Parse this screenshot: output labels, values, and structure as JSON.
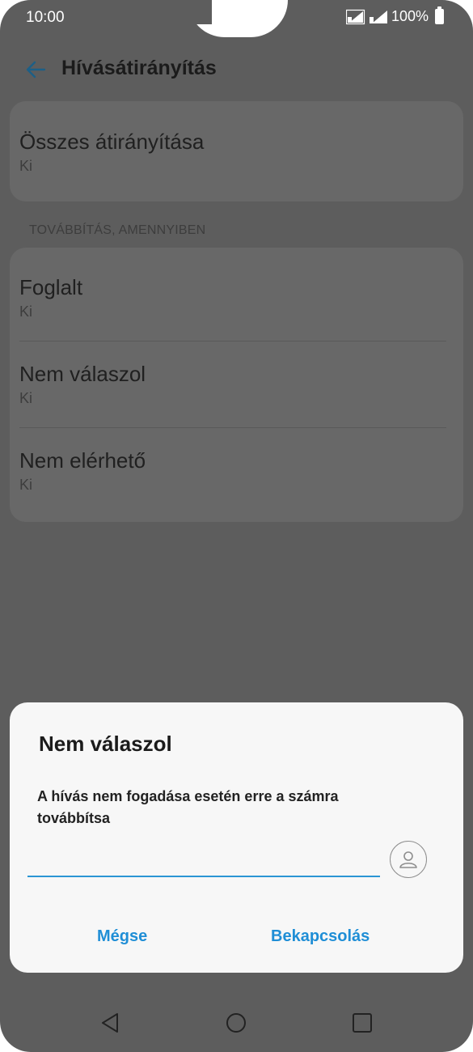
{
  "status_bar": {
    "time": "10:00",
    "battery": "100%"
  },
  "app_bar": {
    "title": "Hívásátirányítás",
    "back_icon": "arrow-back-icon"
  },
  "all_forwarding": {
    "title": "Összes átirányítása",
    "value": "Ki"
  },
  "section": {
    "header": "TOVÁBBÍTÁS, AMENNYIBEN"
  },
  "conditions": [
    {
      "title": "Foglalt",
      "value": "Ki"
    },
    {
      "title": "Nem válaszol",
      "value": "Ki"
    },
    {
      "title": "Nem elérhető",
      "value": "Ki"
    }
  ],
  "dialog": {
    "title": "Nem válaszol",
    "message": "A hívás nem fogadása esetén erre a számra továbbítsa",
    "input_value": "",
    "contact_icon": "contact-person-icon",
    "cancel_label": "Mégse",
    "confirm_label": "Bekapcsolás"
  },
  "colors": {
    "accent": "#1f8ed6",
    "scrim": "#5d5d5d",
    "dialog_bg": "#f7f7f7"
  },
  "nav_bar": {
    "back_icon": "nav-back-triangle-icon",
    "home_icon": "nav-home-circle-icon",
    "recents_icon": "nav-recents-square-icon"
  }
}
